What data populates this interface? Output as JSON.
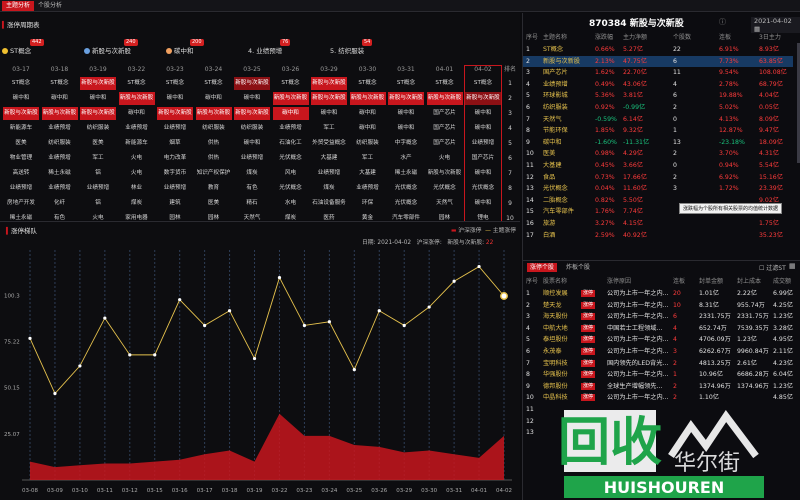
{
  "top_tabs": [
    "主题分析",
    "个股分析"
  ],
  "board": {
    "title": "涨停周期表",
    "legend": [
      {
        "label": "ST概念",
        "badge": "442",
        "color": "#f0c030"
      },
      {
        "label": "新股与次新股",
        "badge": "240",
        "color": "#6aa0e0"
      },
      {
        "label": "碳中和",
        "badge": "200",
        "color": "#f0a060"
      },
      {
        "label": "4. 业绩预增",
        "badge": "76",
        "color": ""
      },
      {
        "label": "5. 纺织服装",
        "badge": "54",
        "color": ""
      }
    ],
    "dates": [
      "03-17",
      "03-18",
      "03-19",
      "03-22",
      "03-23",
      "03-24",
      "03-25",
      "03-26",
      "03-29",
      "03-30",
      "03-31",
      "04-01",
      "04-02"
    ],
    "rank_label": "排名",
    "rows": [
      [
        "ST概念",
        "ST概念",
        "新股与次新股",
        "ST概念",
        "ST概念",
        "ST概念",
        "新股与次新股",
        "ST概念",
        "新股与次新股",
        "ST概念",
        "ST概念",
        "ST概念",
        "ST概念"
      ],
      [
        "碳中和",
        "碳中和",
        "碳中和",
        "新股与次新股",
        "碳中和",
        "碳中和",
        "碳中和",
        "新股与次新股",
        "新股与次新股",
        "新股与次新股",
        "新股与次新股",
        "新股与次新股",
        "新股与次新股"
      ],
      [
        "新股与次新股",
        "新股与次新股",
        "新股与次新股",
        "碳中和",
        "新股与次新股",
        "新股与次新股",
        "新股与次新股",
        "碳中和",
        "碳中和",
        "碳中和",
        "碳中和",
        "国产芯片",
        "碳中和"
      ],
      [
        "新能源车",
        "业绩预增",
        "纺织服装",
        "业绩预增",
        "业绩预增",
        "纺织服装",
        "纺织服装",
        "业绩预增",
        "军工",
        "碳中和",
        "碳中和",
        "国产芯片",
        "碳中和"
      ],
      [
        "医美",
        "纺织服装",
        "医美",
        "新能源车",
        "烟草",
        "供热",
        "碳中和",
        "石油化工",
        "外贸受益概念",
        "纺织服装",
        "中字概念",
        "国产芯片",
        "业绩预增"
      ],
      [
        "物业管理",
        "业绩预增",
        "军工",
        "火电",
        "电力改革",
        "供热",
        "业绩预增",
        "光伏概念",
        "大基建",
        "军工",
        "水产",
        "火电",
        "国产芯片"
      ],
      [
        "高送转",
        "稀土永磁",
        "铝",
        "火电",
        "数字货币",
        "知识产权保护",
        "煤炭",
        "风电",
        "业绩预增",
        "大基建",
        "稀土永磁",
        "新股与次新股",
        "碳中和"
      ],
      [
        "业绩预增",
        "业绩预增",
        "业绩预增",
        "林业",
        "业绩预增",
        "教育",
        "有色",
        "光伏概念",
        "煤炭",
        "业绩预增",
        "光伏概念",
        "光伏概念",
        "光伏概念"
      ],
      [
        "房地产开发",
        "化纤",
        "铝",
        "煤炭",
        "建筑",
        "医美",
        "精石",
        "水电",
        "石油设备服务",
        "环保",
        "光伏概念",
        "天然气",
        "碳中和"
      ],
      [
        "稀土永磁",
        "有色",
        "火电",
        "家用电器",
        "园林",
        "园林",
        "天然气",
        "煤炭",
        "医药",
        "黄金",
        "汽车零部件",
        "园林",
        "锂电"
      ]
    ],
    "red_cells": [
      [
        0,
        2
      ],
      [
        0,
        6
      ],
      [
        0,
        8
      ],
      [
        1,
        3
      ],
      [
        1,
        7
      ],
      [
        1,
        8
      ],
      [
        1,
        9
      ],
      [
        1,
        10
      ],
      [
        1,
        11
      ],
      [
        1,
        12
      ],
      [
        2,
        0
      ],
      [
        2,
        1
      ],
      [
        2,
        2
      ],
      [
        2,
        4
      ],
      [
        2,
        5
      ],
      [
        2,
        6
      ],
      [
        2,
        7
      ]
    ],
    "dark_cells": [
      [
        1,
        12
      ],
      [
        0,
        6
      ]
    ],
    "ranks": [
      "1",
      "2",
      "3",
      "4",
      "5",
      "6",
      "7",
      "8",
      "9",
      "10"
    ]
  },
  "chart": {
    "title": "涨停梯队",
    "legend_a": "沪深涨停",
    "legend_b": "主题涨停",
    "date_label": "日期",
    "date_value": "2021-04-02",
    "info_a_label": "沪深涨停",
    "info_a_value": "",
    "info_b_label": "新股与次新股",
    "info_b_value": "22"
  },
  "chart_data": {
    "type": "line",
    "x": [
      "03-08",
      "03-09",
      "03-10",
      "03-11",
      "03-12",
      "03-15",
      "03-16",
      "03-17",
      "03-18",
      "03-19",
      "03-22",
      "03-23",
      "03-24",
      "03-25",
      "03-26",
      "03-29",
      "03-30",
      "03-31",
      "04-01",
      "04-02"
    ],
    "yticks": [
      25.07,
      50.15,
      75.22,
      100.3
    ],
    "ylim": [
      0,
      125
    ],
    "series": [
      {
        "name": "主题涨停",
        "color": "#e6c24d",
        "values": [
          77,
          47,
          62,
          88,
          68,
          68,
          98,
          84,
          92,
          66,
          110,
          84,
          86,
          60,
          92,
          84,
          94,
          108,
          116,
          100
        ]
      },
      {
        "name": "沪深涨停",
        "color": "#c8161d",
        "values": [
          10,
          7,
          8,
          9,
          9,
          10,
          11,
          14,
          16,
          10,
          36,
          24,
          24,
          19,
          18,
          15,
          16,
          14,
          12,
          24
        ]
      }
    ]
  },
  "right": {
    "title": "870384 新股与次新股",
    "date": "2021-04-02",
    "cols": [
      "序号",
      "主题名称",
      "涨跌幅",
      "主力净额",
      "个股数",
      "连板",
      "3日主力"
    ],
    "rows": [
      [
        "1",
        "ST概念",
        "0.66%",
        "5.27亿",
        "22",
        "6.91%",
        "8.93亿"
      ],
      [
        "2",
        "新股与次新股",
        "2.13%",
        "47.75亿",
        "6",
        "7.73%",
        "63.85亿"
      ],
      [
        "3",
        "国产芯片",
        "1.62%",
        "22.70亿",
        "11",
        "9.54%",
        "108.08亿"
      ],
      [
        "4",
        "业绩预增",
        "0.49%",
        "43.06亿",
        "4",
        "2.78%",
        "68.79亿"
      ],
      [
        "5",
        "环球影城",
        "5.36%",
        "3.81亿",
        "6",
        "19.88%",
        "4.04亿"
      ],
      [
        "6",
        "纺织服装",
        "0.92%",
        "-0.99亿",
        "2",
        "5.02%",
        "0.05亿"
      ],
      [
        "7",
        "天然气",
        "-0.59%",
        "6.14亿",
        "0",
        "4.13%",
        "8.09亿"
      ],
      [
        "8",
        "节能环保",
        "1.85%",
        "9.32亿",
        "1",
        "12.87%",
        "9.47亿"
      ],
      [
        "9",
        "碳中和",
        "-1.60%",
        "-11.31亿",
        "13",
        "-23.18%",
        "18.09亿"
      ],
      [
        "10",
        "医美",
        "0.98%",
        "4.29亿",
        "2",
        "3.70%",
        "4.31亿"
      ],
      [
        "11",
        "大基建",
        "0.45%",
        "3.66亿",
        "0",
        "0.94%",
        "5.54亿"
      ],
      [
        "12",
        "食品",
        "0.73%",
        "17.66亿",
        "2",
        "6.92%",
        "15.16亿"
      ],
      [
        "13",
        "光伏概念",
        "0.04%",
        "11.60亿",
        "3",
        "1.72%",
        "23.39亿"
      ],
      [
        "14",
        "二胎概念",
        "0.82%",
        "5.50亿",
        "",
        "",
        "9.02亿"
      ],
      [
        "15",
        "汽车零部件",
        "1.76%",
        "7.74亿",
        "",
        "",
        "3.27亿"
      ],
      [
        "16",
        "旅游",
        "3.27%",
        "4.15亿",
        "",
        "",
        "1.75亿"
      ],
      [
        "17",
        "白酒",
        "2.59%",
        "40.92亿",
        "",
        "",
        "35.23亿"
      ]
    ],
    "tooltip": "涨跌幅为个股所有相关股票的均值统计数据",
    "tabs": [
      "涨停个股",
      "炸板个股"
    ],
    "filter_label": "过滤ST",
    "cols2": [
      "序号",
      "股票名称",
      "",
      "涨停原因",
      "连板",
      "封单金额",
      "封上成本",
      "成交额"
    ],
    "rows2": [
      [
        "1",
        "顺控发展",
        "",
        "公司为上市一年之内...",
        "20",
        "1.01亿",
        "2.22亿",
        "6.99亿"
      ],
      [
        "2",
        "楚天龙",
        "",
        "公司为上市一年之内...",
        "10",
        "8.31亿",
        "955.74万",
        "4.25亿"
      ],
      [
        "3",
        "海天股份",
        "",
        "公司为上市一年之内...",
        "6",
        "2331.75万",
        "2331.75万",
        "1.23亿"
      ],
      [
        "4",
        "中航大地",
        "",
        "中国若士工程领域...",
        "4",
        "652.74万",
        "7539.35万",
        "3.28亿"
      ],
      [
        "5",
        "泰坦股份",
        "",
        "公司为上市一年之内...",
        "4",
        "4706.09万",
        "1.23亿",
        "4.95亿"
      ],
      [
        "6",
        "永茂泰",
        "",
        "公司为上市一年之内...",
        "3",
        "6262.67万",
        "9960.84万",
        "2.11亿"
      ],
      [
        "7",
        "宝明科技",
        "",
        "国内领先的LED背光...",
        "2",
        "4813.25万",
        "2.61亿",
        "4.23亿"
      ],
      [
        "8",
        "华强股份",
        "",
        "公司为上市一年之内...",
        "1",
        "10.96亿",
        "6686.28万",
        "6.04亿"
      ],
      [
        "9",
        "德邦股份",
        "",
        "全球生产增幅领先...",
        "2",
        "1374.96万",
        "1374.96万",
        "1.23亿"
      ],
      [
        "10",
        "中晶科技",
        "",
        "公司为上市一年之内...",
        "2",
        "1.10亿",
        "",
        "4.85亿"
      ],
      [
        "11",
        "",
        "",
        "",
        "",
        "",
        "",
        ""
      ],
      [
        "12",
        "",
        "",
        "",
        "",
        "",
        "",
        ""
      ],
      [
        "13",
        "",
        "",
        "",
        "",
        "",
        "",
        ""
      ]
    ],
    "row2_tags": [
      "涨停",
      "涨停",
      "涨停",
      "涨停",
      "涨停",
      "涨停",
      "涨停",
      "涨停",
      "涨停",
      "涨停"
    ]
  },
  "watermark": {
    "big": "回收",
    "small_cn": "华尔街",
    "small_en": "HUISHOUREN"
  }
}
